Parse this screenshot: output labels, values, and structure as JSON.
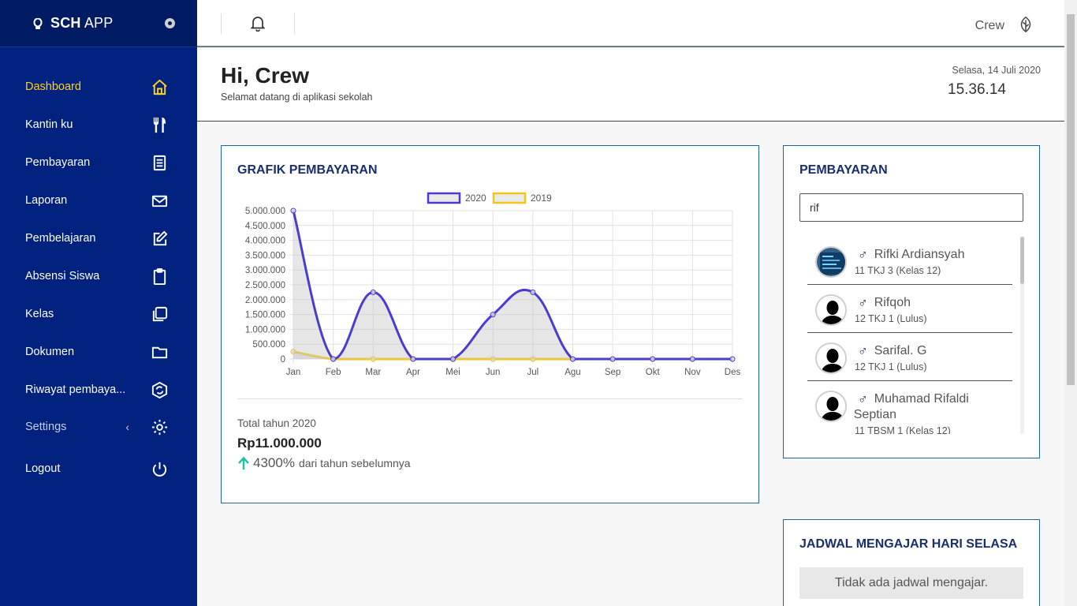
{
  "app": {
    "brand_bold": "SCH",
    "brand_thin": " APP"
  },
  "topbar": {
    "user_name": "Crew"
  },
  "header": {
    "greeting": "Hi, Crew",
    "subtitle": "Selamat datang di aplikasi sekolah",
    "date": "Selasa, 14 Juli 2020",
    "time": "15.36.14"
  },
  "sidebar": {
    "items": [
      {
        "label": "Dashboard",
        "icon": "home-icon",
        "active": true
      },
      {
        "label": "Kantin ku",
        "icon": "utensils-icon"
      },
      {
        "label": "Pembayaran",
        "icon": "receipt-icon"
      },
      {
        "label": "Laporan",
        "icon": "envelope-icon"
      },
      {
        "label": "Pembelajaran",
        "icon": "edit-icon"
      },
      {
        "label": "Absensi Siswa",
        "icon": "clipboard-icon"
      },
      {
        "label": "Kelas",
        "icon": "copy-icon"
      },
      {
        "label": "Dokumen",
        "icon": "folder-icon"
      },
      {
        "label": "Riwayat pembaya...",
        "icon": "sync-icon"
      },
      {
        "label": "Settings",
        "icon": "gear-icon"
      },
      {
        "label": "Logout",
        "icon": "power-icon"
      }
    ]
  },
  "chart_card": {
    "title": "GRAFIK PEMBAYARAN",
    "total_label": "Total tahun 2020",
    "total_value": "Rp11.000.000",
    "growth_pct": "4300%",
    "growth_text": "dari tahun sebelumnya"
  },
  "chart_data": {
    "type": "area",
    "categories": [
      "Jan",
      "Feb",
      "Mar",
      "Apr",
      "Mei",
      "Jun",
      "Jul",
      "Agu",
      "Sep",
      "Okt",
      "Nov",
      "Des"
    ],
    "series": [
      {
        "name": "2020",
        "color": "#4a3ccf",
        "values": [
          5000000,
          0,
          2250000,
          0,
          0,
          1500000,
          2250000,
          0,
          0,
          0,
          0,
          0
        ]
      },
      {
        "name": "2019",
        "color": "#f5c518",
        "values": [
          250000,
          0,
          0,
          0,
          0,
          0,
          0,
          0,
          null,
          null,
          null,
          null
        ]
      }
    ],
    "y_ticks": [
      "0",
      "500.000",
      "1.000.000",
      "1.500.000",
      "2.000.000",
      "2.500.000",
      "3.000.000",
      "3.500.000",
      "4.000.000",
      "4.500.000",
      "5.000.000"
    ],
    "ylim": [
      0,
      5000000
    ],
    "legend_position": "top-center",
    "grid": true
  },
  "pay_card": {
    "title": "PEMBAYARAN",
    "search_value": "rif",
    "students": [
      {
        "name": "Rifki Ardiansyah",
        "class": "11 TKJ 3 (Kelas 12)",
        "gender": "♂"
      },
      {
        "name": "Rifqoh",
        "class": "12 TKJ 1 (Lulus)",
        "gender": "♂"
      },
      {
        "name": "Sarifal. G",
        "class": "12 TKJ 1 (Lulus)",
        "gender": "♂"
      },
      {
        "name": "Muhamad Rifaldi Septian",
        "class": "11 TBSM 1 (Kelas 12)",
        "gender": "♂"
      }
    ]
  },
  "jadwal_card": {
    "title": "JADWAL MENGAJAR HARI SELASA",
    "empty_text": "Tidak ada jadwal mengajar."
  }
}
